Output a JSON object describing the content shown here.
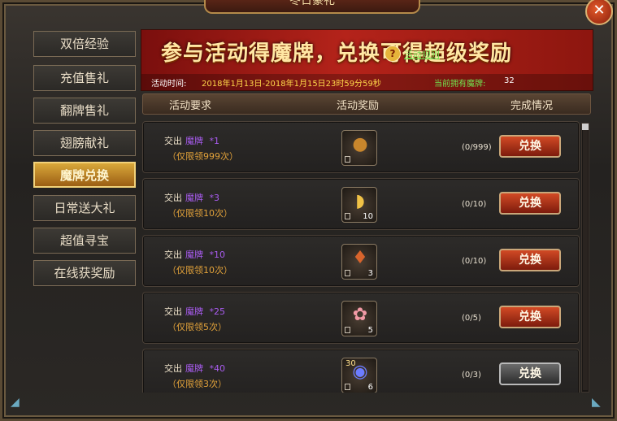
{
  "window": {
    "title": "冬日豪礼"
  },
  "sidebar": {
    "items": [
      {
        "label": "双倍经验"
      },
      {
        "label": "充值售礼"
      },
      {
        "label": "翻牌售礼"
      },
      {
        "label": "翅膀献礼"
      },
      {
        "label": "魔牌兑换",
        "active": true
      },
      {
        "label": "日常送大礼"
      },
      {
        "label": "超值寻宝"
      },
      {
        "label": "在线获奖励"
      }
    ]
  },
  "banner": {
    "title": "参与活动得魔牌，兑换可得超级奖励",
    "time_label": "活动时间:",
    "time_range": "2018年1月13日-2018年1月15日23时59分59秒",
    "coins_label": "当前拥有魔牌:",
    "coins_value": "32",
    "rules_link": "活动规则"
  },
  "table": {
    "col_requirement": "活动要求",
    "col_reward": "活动奖励",
    "col_status": "完成情况"
  },
  "rows": [
    {
      "hand_in": "交出",
      "item": "魔牌",
      "count": "*1",
      "limit": "（仅限领999次）",
      "reward_icon": "money-bag-icon",
      "reward_qty": "",
      "progress": "(0/999)",
      "button": "兑换",
      "enabled": true
    },
    {
      "hand_in": "交出",
      "item": "魔牌",
      "count": "*3",
      "limit": "（仅限领10次）",
      "reward_icon": "gold-ingot-icon",
      "reward_qty": "10",
      "progress": "(0/10)",
      "button": "兑换",
      "enabled": true
    },
    {
      "hand_in": "交出",
      "item": "魔牌",
      "count": "*10",
      "limit": "（仅限领10次）",
      "reward_icon": "lantern-icon",
      "reward_qty": "3",
      "progress": "(0/10)",
      "button": "兑换",
      "enabled": true
    },
    {
      "hand_in": "交出",
      "item": "魔牌",
      "count": "*25",
      "limit": "（仅限领5次）",
      "reward_icon": "lotus-icon",
      "reward_qty": "5",
      "progress": "(0/5)",
      "button": "兑换",
      "enabled": true
    },
    {
      "hand_in": "交出",
      "item": "魔牌",
      "count": "*40",
      "limit": "（仅限领3次）",
      "reward_icon": "skill-orb-icon",
      "reward_qty": "6",
      "reward_badge": "30",
      "progress": "(0/3)",
      "button": "兑换",
      "enabled": false
    }
  ]
}
